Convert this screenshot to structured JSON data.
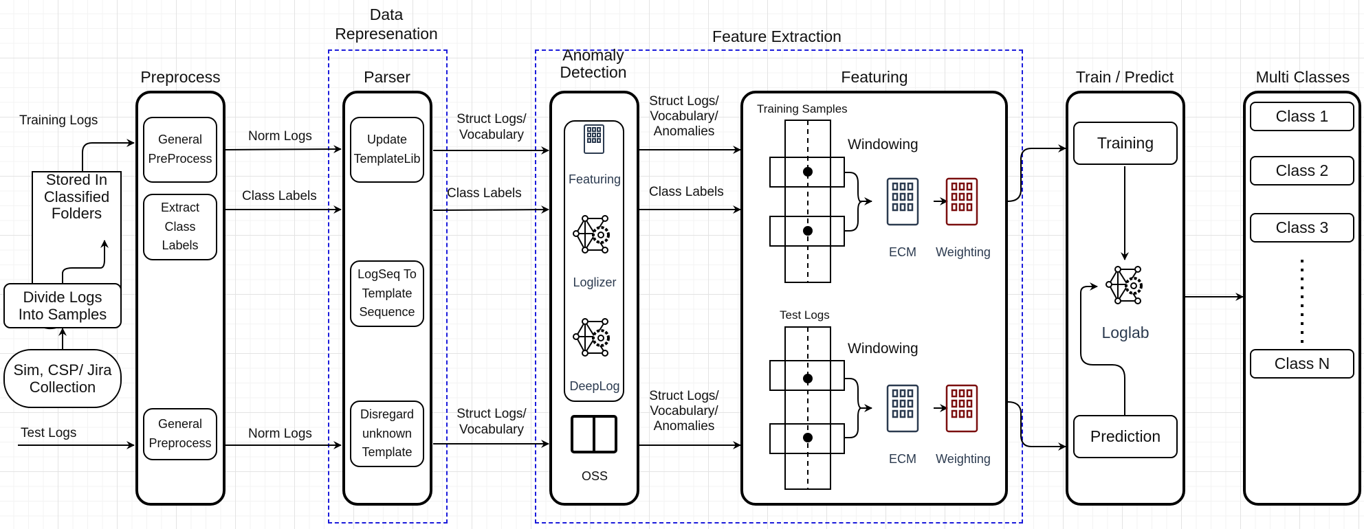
{
  "groups": {
    "data_representation": "Data\nRepresenation",
    "feature_extraction": "Feature Extraction"
  },
  "inputs": {
    "training_logs": "Training Logs",
    "stored_folders": [
      "Stored In",
      "Classified",
      "Folders"
    ],
    "divide_logs": [
      "Divide Logs",
      "Into Samples"
    ],
    "collection": [
      "Sim, CSP/ Jira",
      "Collection"
    ],
    "test_logs": "Test Logs"
  },
  "preprocess": {
    "title": "Preprocess",
    "boxes": [
      [
        "General",
        "PreProcess"
      ],
      [
        "Extract",
        "Class",
        "Labels"
      ],
      [
        "General",
        "Preprocess"
      ]
    ]
  },
  "parser": {
    "title": "Parser",
    "boxes": [
      [
        "Update",
        "TemplateLib"
      ],
      [
        "LogSeq To",
        "Template",
        "Sequence"
      ],
      [
        "Disregard",
        "unknown",
        "Template"
      ]
    ]
  },
  "anomaly_detection": {
    "title": "Anomaly\nDetection",
    "tools": [
      "Featuring",
      "Loglizer",
      "DeepLog"
    ],
    "oss_label": "OSS"
  },
  "featuring": {
    "title": "Featuring",
    "training_samples": "Training Samples",
    "test_logs": "Test Logs",
    "windowing": "Windowing",
    "ecm": "ECM",
    "weighting": "Weighting",
    "colors": {
      "ecm": "#2b3a4f",
      "weighting": "#7a0e0e"
    }
  },
  "train_predict": {
    "title": "Train / Predict",
    "training": "Training",
    "model": "Loglab",
    "prediction": "Prediction"
  },
  "multi_classes": {
    "title": "Multi Classes",
    "classes": [
      "Class 1",
      "Class 2",
      "Class 3",
      "Class N"
    ],
    "ellipsis": "⋮"
  },
  "edges": {
    "norm_logs": "Norm Logs",
    "class_labels": "Class Labels",
    "struct_vocab": [
      "Struct Logs/",
      "Vocabulary"
    ],
    "struct_vocab_anom": [
      "Struct Logs/",
      "Vocabulary/",
      "Anomalies"
    ]
  },
  "colors": {
    "group_border": "#1a1adb",
    "grid": "#e3e3e3"
  }
}
